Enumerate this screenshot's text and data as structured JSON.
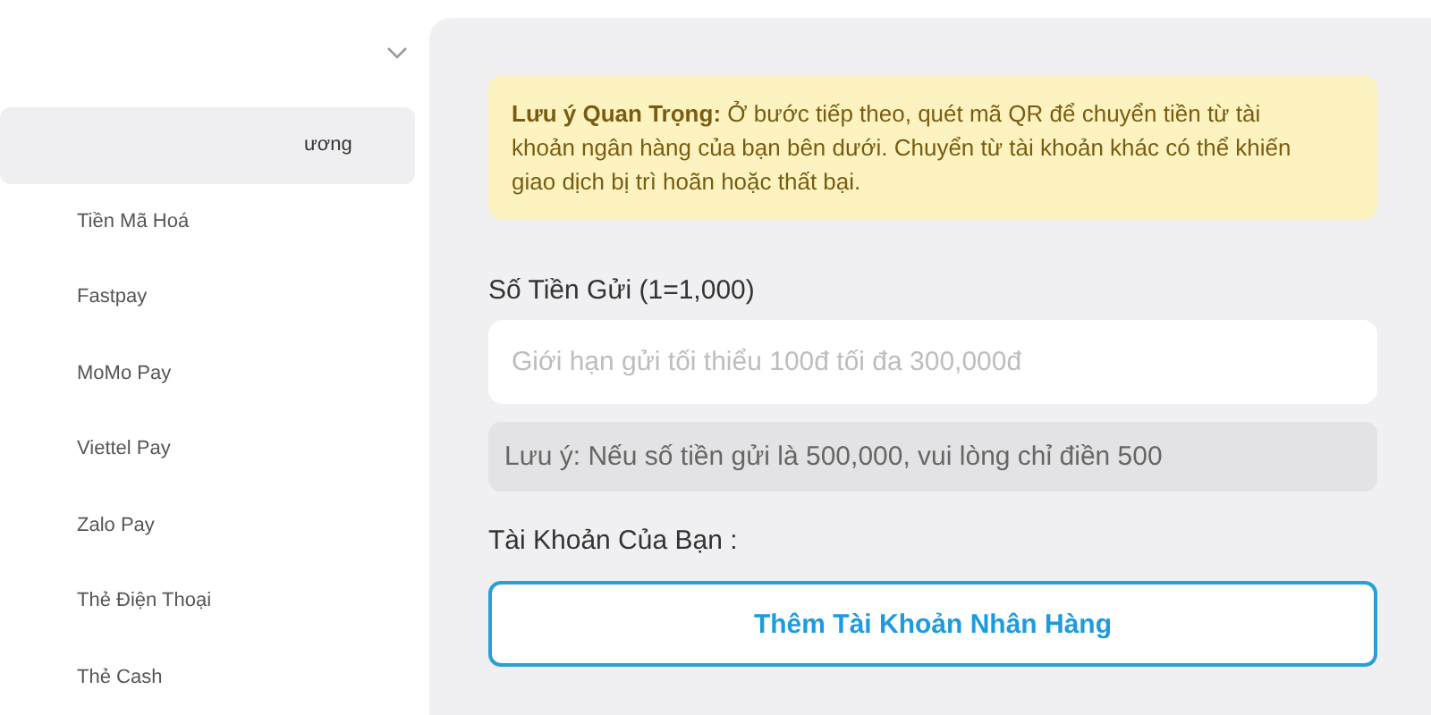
{
  "sidebar": {
    "items": [
      {
        "label": "ương",
        "selected": true
      },
      {
        "label": "Tiền Mã Hoá",
        "selected": false
      },
      {
        "label": "Fastpay",
        "selected": false
      },
      {
        "label": "MoMo Pay",
        "selected": false
      },
      {
        "label": "Viettel Pay",
        "selected": false
      },
      {
        "label": "Zalo Pay",
        "selected": false
      },
      {
        "label": "Thẻ Điện Thoại",
        "selected": false
      },
      {
        "label": "Thẻ Cash",
        "selected": false
      }
    ]
  },
  "notice": {
    "text": "**Lưu ý Quan Trọng:** Ở bước tiếp theo, quét mã QR để chuyển tiền từ tài khoản ngân hàng của bạn bên dưới. Chuyển từ tài khoản khác có thể khiến giao dịch bị trì hoãn hoặc thất bại."
  },
  "amount": {
    "label": "Số Tiền Gửi (1=1,000)",
    "placeholder": "Giới hạn gửi tối thiểu 100đ tối đa 300,000đ",
    "hint": "Lưu ý: Nếu số tiền gửi là 500,000, vui lòng chỉ điền 500"
  },
  "account": {
    "label": "Tài Khoản Của Bạn :",
    "button": "Thêm Tài Khoản Nhân Hàng"
  }
}
